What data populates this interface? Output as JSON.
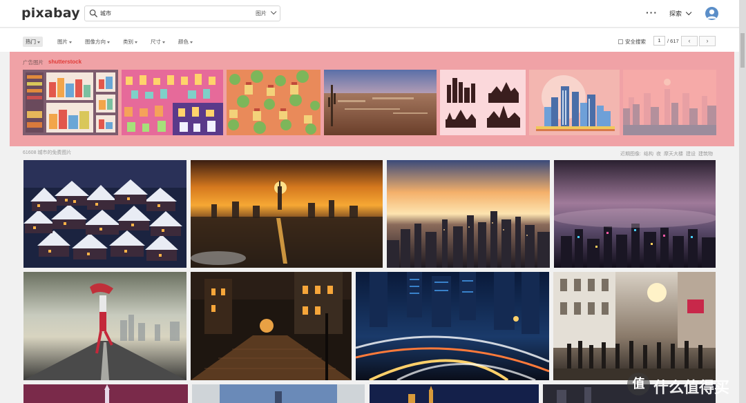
{
  "header": {
    "logo": "pixabay",
    "search_value": "城市",
    "search_type": "图片",
    "more_label": "···",
    "explore_label": "探索"
  },
  "filters": [
    {
      "label": "热门",
      "active": true
    },
    {
      "label": "图片",
      "active": false
    },
    {
      "label": "图像方向",
      "active": false
    },
    {
      "label": "类别",
      "active": false
    },
    {
      "label": "尺寸",
      "active": false
    },
    {
      "label": "颜色",
      "active": false
    }
  ],
  "pagination": {
    "safe_search_label": "安全搜索",
    "current_page": "1",
    "total": "/ 617",
    "prev_icon": "‹",
    "next_icon": "›"
  },
  "ad": {
    "label": "广告图片",
    "brand": "shutterstock"
  },
  "results": {
    "count_label": "61608 城市的免费图片",
    "related_label": "近期图像:",
    "related_tags": [
      "结构",
      "夜",
      "摩天大楼",
      "建设",
      "建筑物"
    ]
  },
  "watermark": {
    "badge": "值",
    "text": "什么值得买"
  },
  "colors": {
    "ad_bg": "#f0a2a6",
    "brand_red": "#e03a36"
  }
}
